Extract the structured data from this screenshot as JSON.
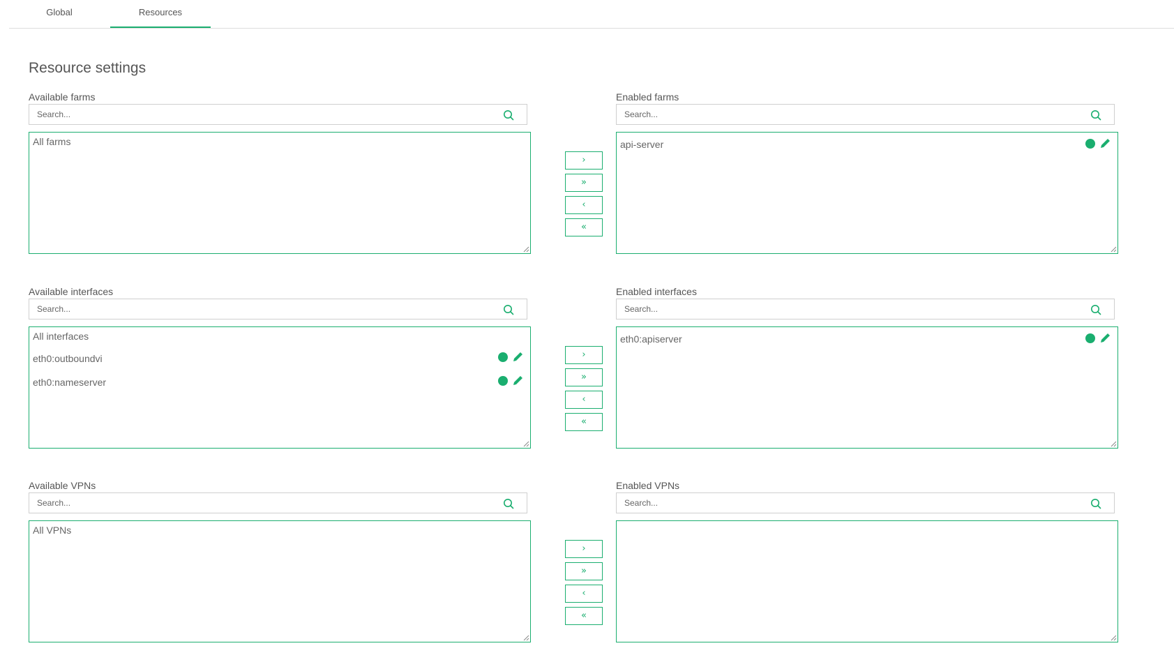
{
  "tabs": [
    {
      "label": "Global",
      "active": false
    },
    {
      "label": "Resources",
      "active": true
    }
  ],
  "page_title": "Resource settings",
  "accent_color": "#1aae6f",
  "search_placeholder": "Search...",
  "transfer_buttons": {
    "move_right": "›",
    "move_all_right": "»",
    "move_left": "‹",
    "move_all_left": "«"
  },
  "sections": [
    {
      "available": {
        "label": "Available farms",
        "items": [
          "All farms"
        ]
      },
      "enabled": {
        "label": "Enabled farms",
        "items": [
          "api-server"
        ]
      }
    },
    {
      "available": {
        "label": "Available interfaces",
        "items": [
          "All interfaces",
          "eth0:outboundvi",
          "eth0:nameserver"
        ]
      },
      "enabled": {
        "label": "Enabled interfaces",
        "items": [
          "eth0:apiserver"
        ]
      }
    },
    {
      "available": {
        "label": "Available VPNs",
        "items": [
          "All VPNs"
        ]
      },
      "enabled": {
        "label": "Enabled VPNs",
        "items": []
      }
    }
  ]
}
